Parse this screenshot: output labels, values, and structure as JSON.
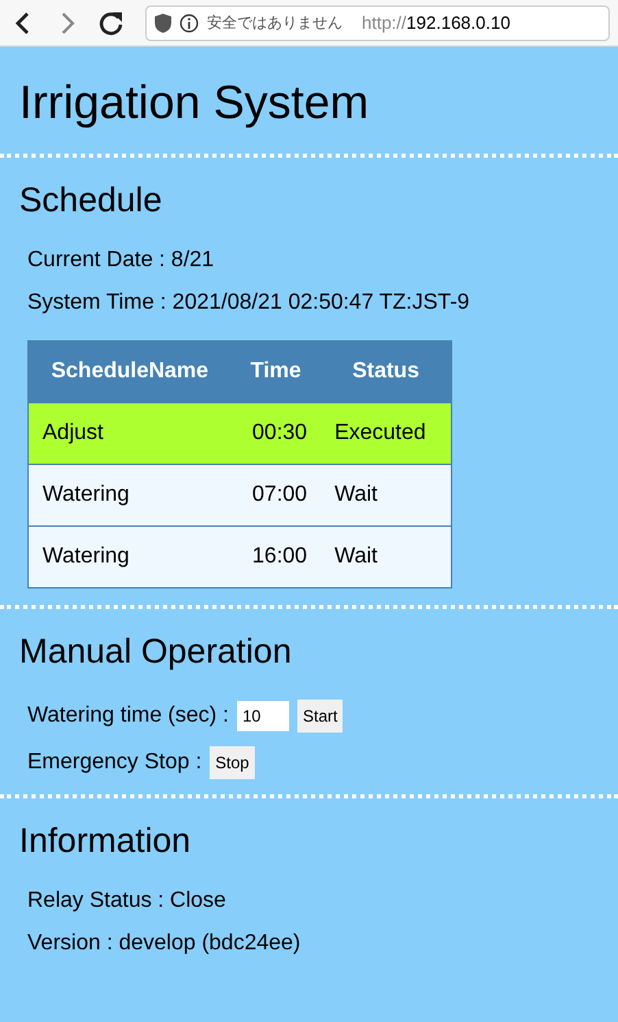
{
  "browser": {
    "security_label": "安全ではありません",
    "url_scheme": "http://",
    "url_host": "192.168.0.10"
  },
  "title": "Irrigation System",
  "schedule": {
    "heading": "Schedule",
    "lines": [
      "Current Date : 8/21",
      "System Time : 2021/08/21 02:50:47 TZ:JST-9"
    ],
    "table": {
      "columns": [
        "ScheduleName",
        "Time",
        "Status"
      ],
      "rows": [
        {
          "name": "Adjust",
          "time": "00:30",
          "status": "Executed",
          "highlighted": true
        },
        {
          "name": "Watering",
          "time": "07:00",
          "status": "Wait",
          "highlighted": false
        },
        {
          "name": "Watering",
          "time": "16:00",
          "status": "Wait",
          "highlighted": false
        }
      ]
    }
  },
  "manual": {
    "heading": "Manual Operation",
    "watering_label": "Watering time (sec) :",
    "watering_value": "10",
    "start_button": "Start",
    "stop_label": "Emergency Stop :",
    "stop_button": "Stop"
  },
  "information": {
    "heading": "Information",
    "lines": [
      "Relay Status : Close",
      "Version : develop (bdc24ee)"
    ]
  }
}
